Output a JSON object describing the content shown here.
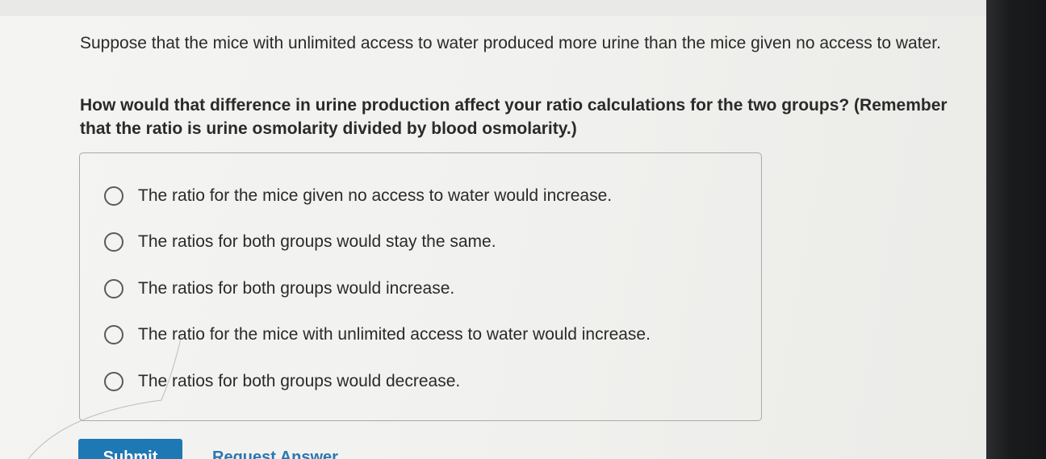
{
  "question": {
    "intro": "Suppose that the mice with unlimited access to water produced more urine than the mice given no access to water.",
    "prompt": "How would that difference in urine production affect your ratio calculations for the two groups? (Remember that the ratio is urine osmolarity divided by blood osmolarity.)"
  },
  "options": [
    {
      "label": "The ratio for the mice given no access to water would increase."
    },
    {
      "label": "The ratios for both groups would stay the same."
    },
    {
      "label": "The ratios for both groups would increase."
    },
    {
      "label": "The ratio for the mice with unlimited access to water would increase."
    },
    {
      "label": "The ratios for both groups would decrease."
    }
  ],
  "actions": {
    "submit_label": "Submit",
    "request_answer_label": "Request Answer"
  },
  "colors": {
    "accent": "#1e78b3",
    "link": "#2a78b0",
    "text": "#2a2a2a"
  }
}
